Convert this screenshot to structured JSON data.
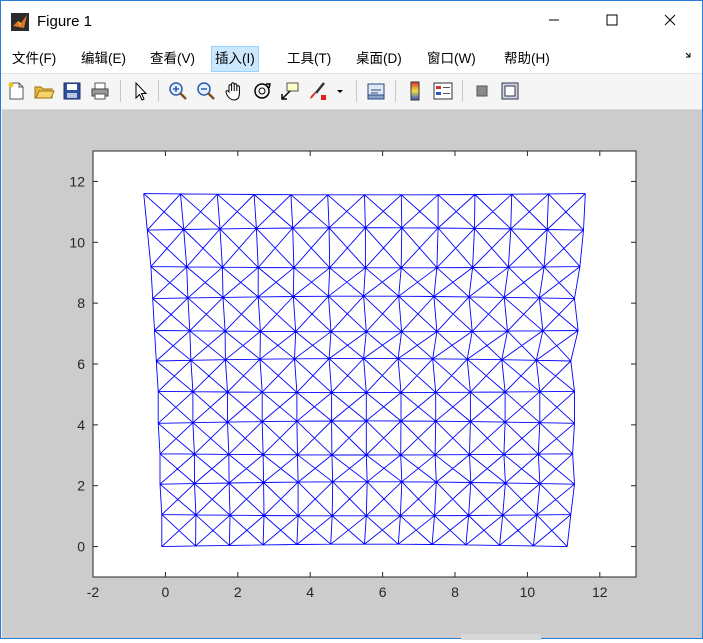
{
  "window": {
    "title": "Figure 1",
    "controls": {
      "minimize": "minimize-icon",
      "maximize": "maximize-icon",
      "close": "close-icon"
    }
  },
  "menubar": {
    "items": [
      {
        "label": "文件(F)"
      },
      {
        "label": "编辑(E)"
      },
      {
        "label": "查看(V)"
      },
      {
        "label": "插入(I)"
      },
      {
        "label": "工具(T)"
      },
      {
        "label": "桌面(D)"
      },
      {
        "label": "窗口(W)"
      },
      {
        "label": "帮助(H)"
      }
    ],
    "overflow_icon": "chevron-right-icon"
  },
  "toolbar": {
    "buttons": [
      "new-figure-icon",
      "open-file-icon",
      "save-icon",
      "print-icon",
      "pointer-icon",
      "zoom-in-icon",
      "zoom-out-icon",
      "pan-icon",
      "rotate-3d-icon",
      "data-cursor-icon",
      "brush-icon",
      "link-plot-icon",
      "colorbar-icon",
      "legend-icon",
      "hide-plot-tools-icon",
      "show-plot-tools-icon"
    ]
  },
  "colors": {
    "mesh": "#0000ff",
    "figure_bg": "#cccccc",
    "axes_bg": "#ffffff"
  },
  "chart_data": {
    "type": "line",
    "description_of_series": "2D triangulated quad mesh, 12 columns x 11 rows of cells, each cell with both diagonals",
    "xlim": [
      -2,
      13
    ],
    "ylim": [
      -1,
      13
    ],
    "xticks": [
      -2,
      0,
      2,
      4,
      6,
      8,
      10,
      12
    ],
    "yticks": [
      0,
      2,
      4,
      6,
      8,
      10,
      12
    ],
    "title": "",
    "xlabel": "",
    "ylabel": "",
    "grid": false,
    "mesh_rows_y": [
      0,
      1.05,
      2.05,
      3.05,
      4.05,
      5.1,
      6.1,
      7.1,
      8.15,
      9.2,
      10.4,
      11.6
    ],
    "mesh_left_x": [
      -0.1,
      -0.1,
      -0.15,
      -0.15,
      -0.2,
      -0.2,
      -0.25,
      -0.3,
      -0.35,
      -0.4,
      -0.5,
      -0.6
    ],
    "mesh_right_x": [
      11.1,
      11.2,
      11.3,
      11.25,
      11.3,
      11.3,
      11.2,
      11.4,
      11.3,
      11.45,
      11.55,
      11.6
    ],
    "mesh_columns": 12
  }
}
